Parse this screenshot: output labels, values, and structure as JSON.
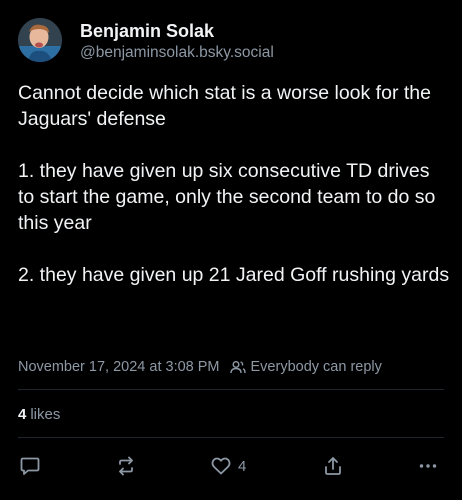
{
  "author": {
    "display_name": "Benjamin Solak",
    "handle": "@benjaminsolak.bsky.social"
  },
  "post": {
    "paragraphs": [
      "Cannot decide which stat is a worse look for the Jaguars' defense",
      "1. they have given up six consecutive TD drives to start the game, only the second team to do so this year",
      "2. they have given up 21 Jared Goff rushing yards"
    ],
    "timestamp": "November 17, 2024 at 3:08 PM",
    "reply_setting": "Everybody can reply"
  },
  "engagement": {
    "likes_count": "4",
    "likes_label": "likes"
  },
  "actions": {
    "like_count": "4",
    "icons": [
      "reply-icon",
      "repost-icon",
      "like-icon",
      "share-icon",
      "more-icon"
    ]
  },
  "colors": {
    "background": "#000000",
    "text": "#f1f3f5",
    "muted": "#8d98a5",
    "divider": "#1f262e"
  }
}
